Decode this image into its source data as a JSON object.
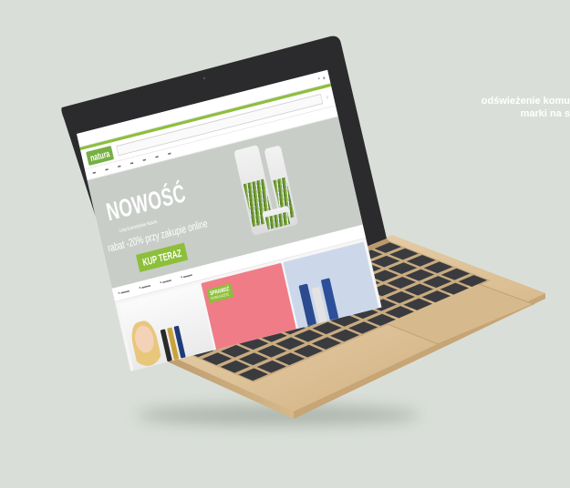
{
  "caption": {
    "line1": "odświeżenie komu",
    "line2": "marki na s"
  },
  "site": {
    "logo": "natura",
    "hero": {
      "title": "NOWOŚĆ",
      "subtitle": "Linia kosmetyków Natura",
      "promo": "rabat -20% przy zakupie online",
      "cta": "KUP TERAZ"
    },
    "tile_badge": {
      "line1": "SPRAWDŹ",
      "line2": "NOWĄ GAZETĘ"
    }
  },
  "colors": {
    "accent": "#8dbf3b",
    "background": "#d9dfd8",
    "laptop": "#d9bf99"
  }
}
